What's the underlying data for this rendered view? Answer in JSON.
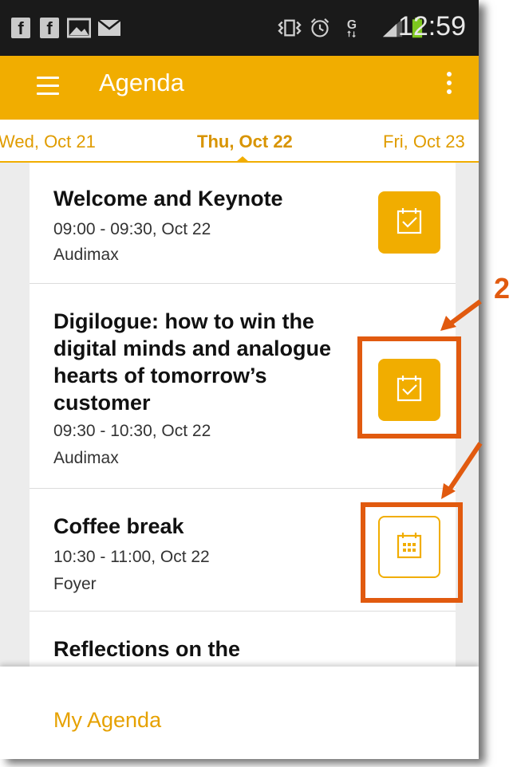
{
  "status_bar": {
    "time": "12:59",
    "left_icons": [
      "facebook-icon",
      "facebook-icon",
      "image-icon",
      "mail-icon"
    ],
    "right_icons": [
      "vibrate-icon",
      "alarm-icon",
      "data-icon",
      "signal-icon",
      "battery-icon"
    ]
  },
  "app_bar": {
    "title": "Agenda"
  },
  "date_tabs": [
    {
      "label": "Wed, Oct 21"
    },
    {
      "label": "Thu, Oct 22",
      "active": true
    },
    {
      "label": "Fri, Oct 23"
    }
  ],
  "sessions": [
    {
      "title": "Welcome and Keynote",
      "time": "09:00 - 09:30, Oct 22",
      "room": "Audimax",
      "in_my_agenda": true
    },
    {
      "title": "Digilogue: how to win the digital minds and analogue hearts of tomorrow’s customer",
      "time": "09:30 - 10:30, Oct 22",
      "room": "Audimax",
      "in_my_agenda": true
    },
    {
      "title": "Coffee break",
      "time": "10:30 - 11:00, Oct 22",
      "room": "Foyer",
      "in_my_agenda": false
    },
    {
      "title": "Reflections on the Transformation to",
      "time": "",
      "room": ""
    }
  ],
  "bottom_sheet": {
    "label": "My Agenda"
  },
  "annotation": {
    "number": "2",
    "color": "#e15a0f"
  },
  "colors": {
    "accent": "#f1ad00",
    "status_bar": "#1a1a1a",
    "annotation": "#e15a0f"
  }
}
